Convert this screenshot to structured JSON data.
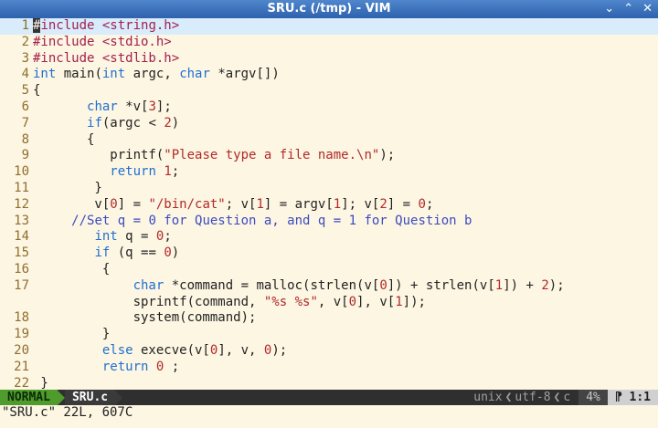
{
  "window": {
    "title": "SRU.c (/tmp) - VIM",
    "buttons": [
      "⌄",
      "⌃",
      "✕"
    ]
  },
  "editor": {
    "lines": [
      {
        "n": "1",
        "parts": [
          [
            "cursor",
            "#"
          ],
          [
            "pp",
            "include <string.h>"
          ]
        ],
        "cursorline": true
      },
      {
        "n": "2",
        "parts": [
          [
            "pp",
            "#include <stdio.h>"
          ]
        ]
      },
      {
        "n": "3",
        "parts": [
          [
            "pp",
            "#include <stdlib.h>"
          ]
        ]
      },
      {
        "n": "4",
        "parts": [
          [
            "kw",
            "int"
          ],
          [
            "",
            " main("
          ],
          [
            "kw",
            "int"
          ],
          [
            "",
            " argc, "
          ],
          [
            "kw",
            "char"
          ],
          [
            "",
            " *argv[])"
          ]
        ]
      },
      {
        "n": "5",
        "parts": [
          [
            "",
            "{"
          ]
        ]
      },
      {
        "n": "6",
        "parts": [
          [
            "",
            "       "
          ],
          [
            "kw",
            "char"
          ],
          [
            "",
            " *v["
          ],
          [
            "num",
            "3"
          ],
          [
            "",
            "];"
          ]
        ]
      },
      {
        "n": "7",
        "parts": [
          [
            "",
            "       "
          ],
          [
            "kw",
            "if"
          ],
          [
            "",
            "(argc < "
          ],
          [
            "num",
            "2"
          ],
          [
            "",
            ")"
          ]
        ]
      },
      {
        "n": "8",
        "parts": [
          [
            "",
            "       {"
          ]
        ]
      },
      {
        "n": "9",
        "parts": [
          [
            "",
            "          printf("
          ],
          [
            "str",
            "\"Please type a file name.\\n\""
          ],
          [
            "",
            ");"
          ]
        ]
      },
      {
        "n": "10",
        "parts": [
          [
            "",
            "          "
          ],
          [
            "kw",
            "return"
          ],
          [
            "",
            " "
          ],
          [
            "num",
            "1"
          ],
          [
            "",
            ";"
          ]
        ]
      },
      {
        "n": "11",
        "parts": [
          [
            "",
            "        }"
          ]
        ]
      },
      {
        "n": "12",
        "parts": [
          [
            "",
            "        v["
          ],
          [
            "num",
            "0"
          ],
          [
            "",
            "] = "
          ],
          [
            "str",
            "\"/bin/cat\""
          ],
          [
            "",
            "; v["
          ],
          [
            "num",
            "1"
          ],
          [
            "",
            "] = argv["
          ],
          [
            "num",
            "1"
          ],
          [
            "",
            "]; v["
          ],
          [
            "num",
            "2"
          ],
          [
            "",
            "] = "
          ],
          [
            "num",
            "0"
          ],
          [
            "",
            ";"
          ]
        ]
      },
      {
        "n": "13",
        "parts": [
          [
            "",
            "     "
          ],
          [
            "cmt",
            "//Set q = 0 for Question a, and q = 1 for Question b"
          ]
        ]
      },
      {
        "n": "14",
        "parts": [
          [
            "",
            "        "
          ],
          [
            "kw",
            "int"
          ],
          [
            "",
            " q = "
          ],
          [
            "num",
            "0"
          ],
          [
            "",
            ";"
          ]
        ]
      },
      {
        "n": "15",
        "parts": [
          [
            "",
            "        "
          ],
          [
            "kw",
            "if"
          ],
          [
            "",
            " (q == "
          ],
          [
            "num",
            "0"
          ],
          [
            "",
            ")"
          ]
        ]
      },
      {
        "n": "16",
        "parts": [
          [
            "",
            "         {"
          ]
        ]
      },
      {
        "n": "17",
        "parts": [
          [
            "",
            "             "
          ],
          [
            "kw",
            "char"
          ],
          [
            "",
            " *command = malloc(strlen(v["
          ],
          [
            "num",
            "0"
          ],
          [
            "",
            "]) + strlen(v["
          ],
          [
            "num",
            "1"
          ],
          [
            "",
            "]) + "
          ],
          [
            "num",
            "2"
          ],
          [
            "",
            ");"
          ]
        ]
      },
      {
        "n": "",
        "parts": [
          [
            "",
            "             sprintf(command, "
          ],
          [
            "str",
            "\"%s %s\""
          ],
          [
            "",
            ", v["
          ],
          [
            "num",
            "0"
          ],
          [
            "",
            "], v["
          ],
          [
            "num",
            "1"
          ],
          [
            "",
            "]);"
          ]
        ]
      },
      {
        "n": "18",
        "parts": [
          [
            "",
            "             system(command);"
          ]
        ]
      },
      {
        "n": "19",
        "parts": [
          [
            "",
            "         }"
          ]
        ]
      },
      {
        "n": "20",
        "parts": [
          [
            "",
            "         "
          ],
          [
            "kw",
            "else"
          ],
          [
            "",
            " execve(v["
          ],
          [
            "num",
            "0"
          ],
          [
            "",
            "], v, "
          ],
          [
            "num",
            "0"
          ],
          [
            "",
            ");"
          ]
        ]
      },
      {
        "n": "21",
        "parts": [
          [
            "",
            "         "
          ],
          [
            "kw",
            "return"
          ],
          [
            "",
            " "
          ],
          [
            "num",
            "0"
          ],
          [
            "",
            " ;"
          ]
        ]
      },
      {
        "n": "22",
        "parts": [
          [
            "",
            " }"
          ]
        ]
      }
    ]
  },
  "statusline": {
    "mode": "NORMAL",
    "filename": "SRU.c",
    "fileformat": "unix",
    "encoding": "utf-8",
    "filetype": "c",
    "percent": "4%",
    "position_line": "1",
    "position_col": ":1",
    "position_icon": "⁋"
  },
  "cmdline": {
    "message": "\"SRU.c\" 22L, 607C"
  }
}
